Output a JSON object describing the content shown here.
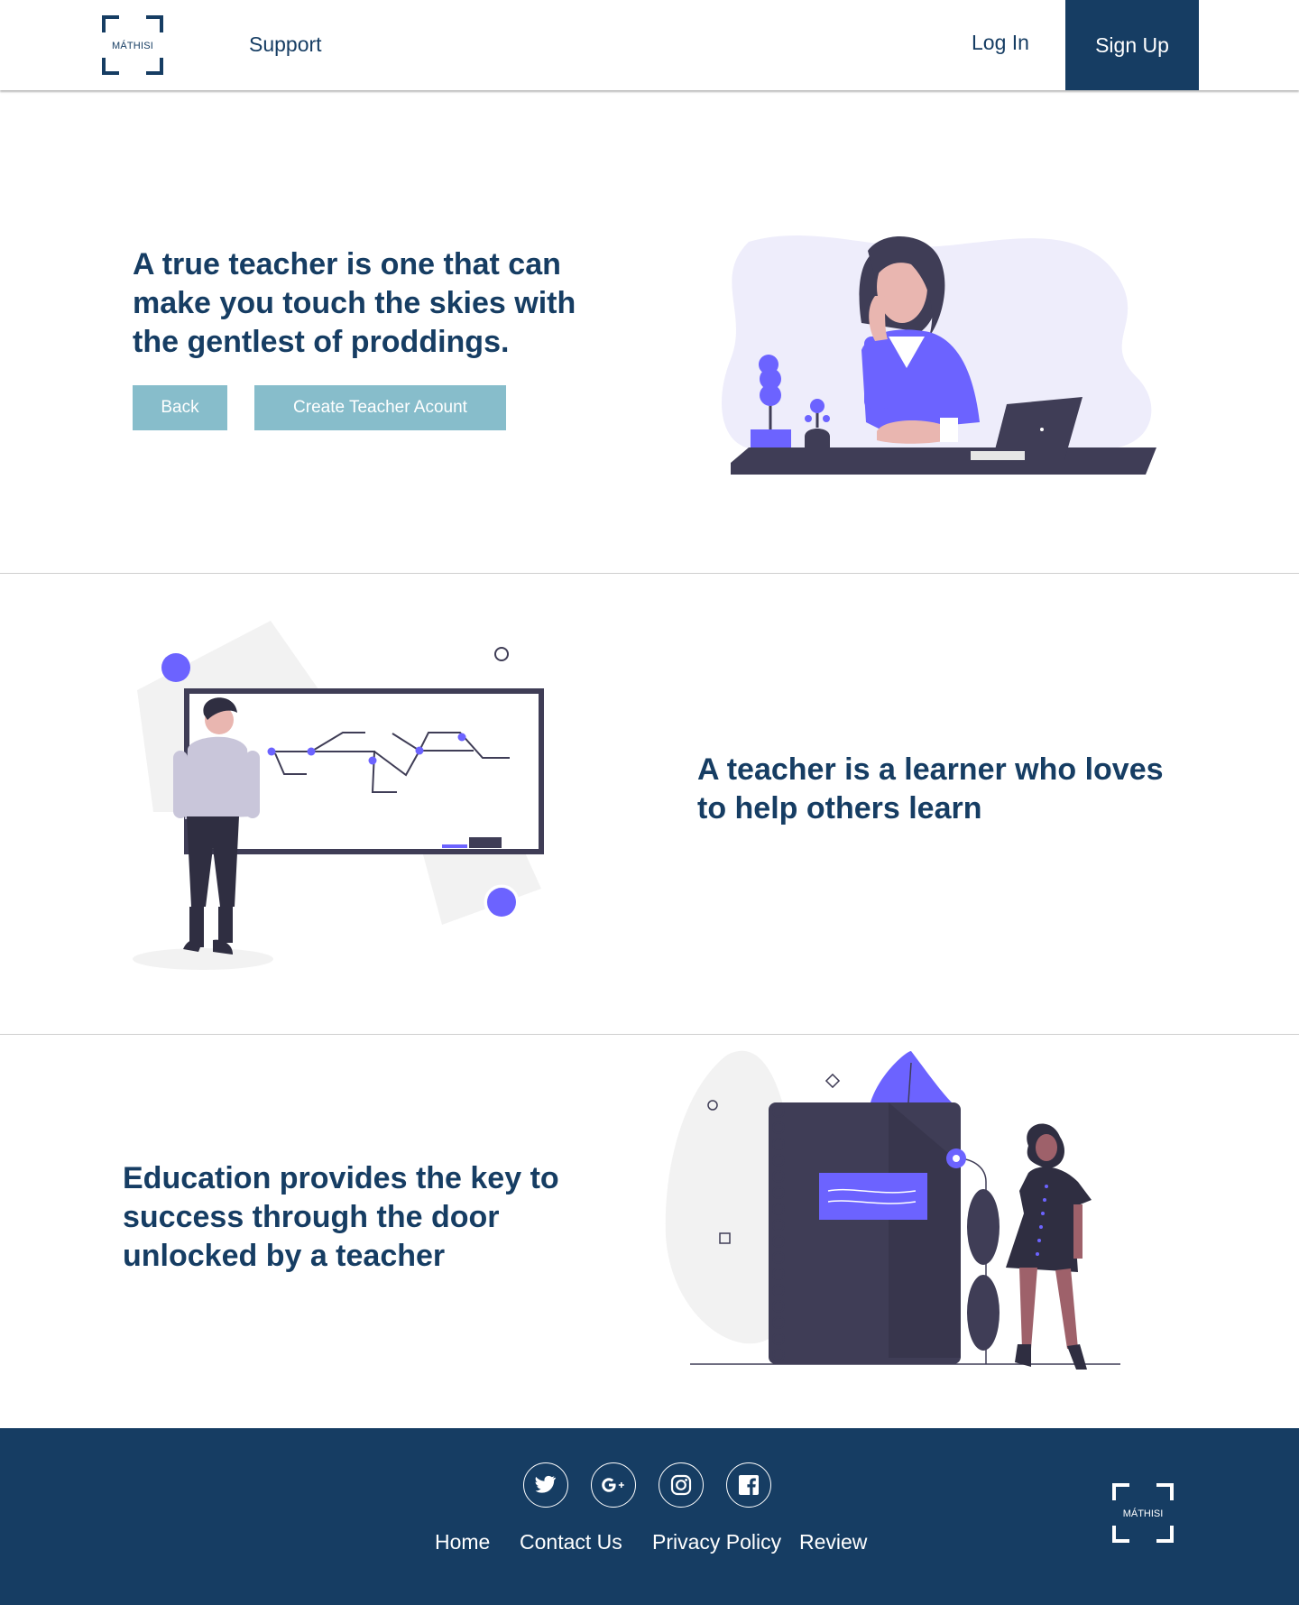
{
  "nav": {
    "logo_text": "MÁTHISI",
    "support": "Support",
    "login": "Log In",
    "signup": "Sign Up"
  },
  "hero": {
    "quote": "A true teacher is one that can make you touch the skies with the gentlest of proddings.",
    "back_button": "Back",
    "create_button": "Create Teacher Acount"
  },
  "section2": {
    "quote": "A teacher is a learner who loves to help others learn"
  },
  "section3": {
    "quote": "Education provides the key to success through the door unlocked by a teacher"
  },
  "footer": {
    "social": [
      "twitter-icon",
      "google-plus-icon",
      "instagram-icon",
      "facebook-icon"
    ],
    "links": [
      "Home",
      "Contact Us",
      "Privacy Policy",
      "Review"
    ],
    "logo_text": "MÁTHISI"
  },
  "colors": {
    "brand": "#163d63",
    "button": "#87bdcb",
    "accent": "#6c63ff",
    "dark": "#3f3d56"
  }
}
